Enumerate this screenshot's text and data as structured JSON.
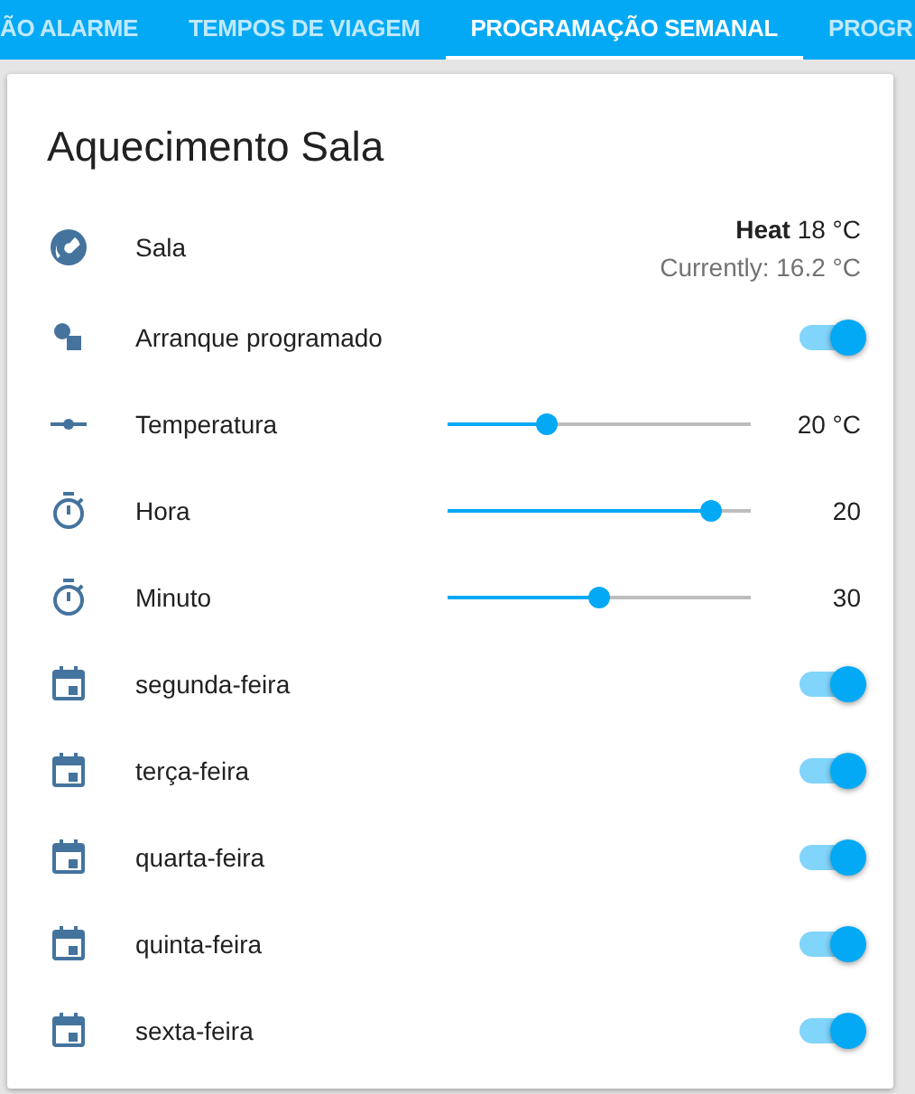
{
  "tabs": [
    {
      "label": "ÃO ALARME",
      "selected": false
    },
    {
      "label": "TEMPOS DE VIAGEM",
      "selected": false
    },
    {
      "label": "PROGRAMAÇÃO SEMANAL",
      "selected": true
    },
    {
      "label": "PROGR",
      "selected": false
    }
  ],
  "card": {
    "title": "Aquecimento Sala",
    "rows": [
      {
        "kind": "climate",
        "name": "Sala",
        "state": "**Heat** 18 °C",
        "current": "Currently: 16.2 °C"
      },
      {
        "kind": "schedule_toggle",
        "name": "Arranque programado",
        "on": true
      },
      {
        "kind": "temperature_slider",
        "name": "Temperatura",
        "level": 0.33,
        "value": "20 °C"
      },
      {
        "kind": "time_slider",
        "name": "Hora",
        "level": 0.87,
        "value": "20"
      },
      {
        "kind": "time_slider",
        "name": "Minuto",
        "level": 0.5,
        "value": "30"
      },
      {
        "kind": "day_toggle",
        "name": "segunda-feira",
        "on": true
      },
      {
        "kind": "day_toggle",
        "name": "terça-feira",
        "on": true
      },
      {
        "kind": "day_toggle",
        "name": "quarta-feira",
        "on": true
      },
      {
        "kind": "day_toggle",
        "name": "quinta-feira",
        "on": true
      },
      {
        "kind": "day_toggle",
        "name": "sexta-feira",
        "on": true
      }
    ]
  }
}
